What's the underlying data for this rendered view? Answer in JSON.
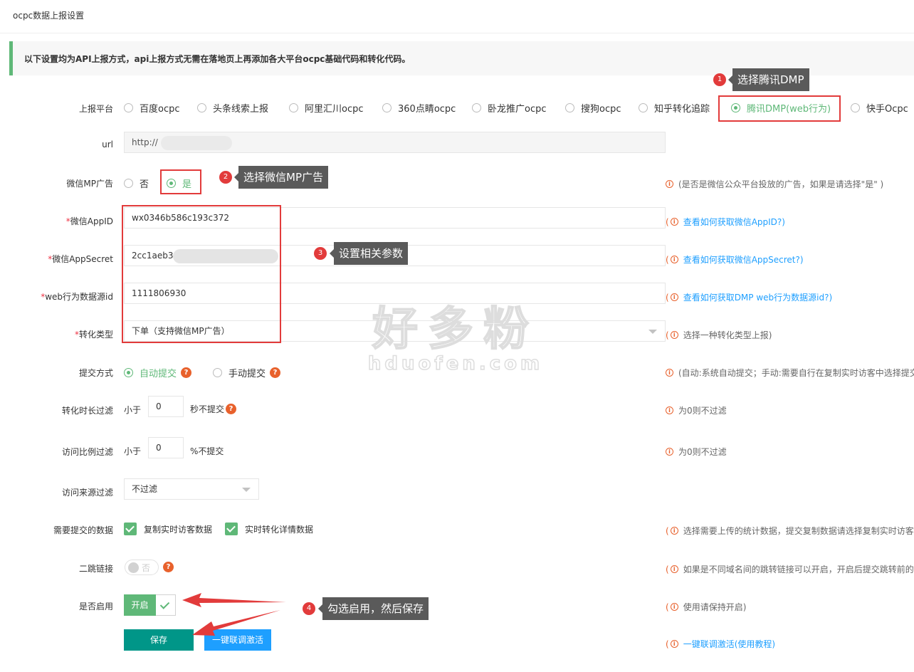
{
  "page_title": "ocpc数据上报设置",
  "notice": "以下设置均为API上报方式，api上报方式无需在落地页上再添加各大平台ocpc基础代码和转化代码。",
  "platform": {
    "label": "上报平台",
    "options": [
      "百度ocpc",
      "头条线索上报",
      "阿里汇川ocpc",
      "360点睛ocpc",
      "卧龙推广ocpc",
      "搜狗ocpc",
      "知乎转化追踪",
      "腾讯DMP(web行为)",
      "快手Ocpc"
    ],
    "selected": "腾讯DMP(web行为)"
  },
  "url": {
    "label": "url",
    "value": "http://"
  },
  "wechat_mp": {
    "label": "微信MP广告",
    "no": "否",
    "yes": "是",
    "tip": "(是否是微信公众平台投放的广告，如果是请选择\"是\" )"
  },
  "appid": {
    "required": "*",
    "label": "微信AppID",
    "value": "wx0346b586c193c372",
    "tip_paren": "(",
    "tip_link": "查看如何获取微信AppID?)"
  },
  "appsecret": {
    "required": "*",
    "label": "微信AppSecret",
    "value": "2cc1aeb3",
    "tip_paren": "(",
    "tip_link": "查看如何获取微信AppSecret?)"
  },
  "web_source": {
    "required": "*",
    "label": "web行为数据源id",
    "value": "1111806930",
    "tip_paren": "(",
    "tip_link": "查看如何获取DMP web行为数据源id?)"
  },
  "conversion": {
    "required": "*",
    "label": "转化类型",
    "value": "下单（支持微信MP广告）",
    "tip": "选择一种转化类型上报)"
  },
  "submit_mode": {
    "label": "提交方式",
    "auto": "自动提交",
    "manual": "手动提交",
    "q": "?",
    "tip": "(自动:系统自动提交；手动:需要自行在复制实时访客中选择提交"
  },
  "duration_filter": {
    "label": "转化时长过滤",
    "prefix": "小于",
    "value": "0",
    "suffix": "秒不提交",
    "q": "?",
    "tip": "为0则不过滤"
  },
  "ratio_filter": {
    "label": "访问比例过滤",
    "prefix": "小于",
    "value": "0",
    "suffix": "%不提交",
    "tip": "为0则不过滤"
  },
  "source_filter": {
    "label": "访问来源过滤",
    "value": "不过滤"
  },
  "data_to_submit": {
    "label": "需要提交的数据",
    "opt1": "复制实时访客数据",
    "opt2": "实时转化详情数据",
    "tip": "选择需要上传的统计数据，提交复制数据请选择复制实时访客,"
  },
  "redirect": {
    "label": "二跳链接",
    "switch_text": "否",
    "q": "?",
    "tip": "如果是不同域名间的跳转链接可以开启，开启后提交跳转前的链"
  },
  "enable": {
    "label": "是否启用",
    "on_text": "开启",
    "tip": "使用请保持开启)"
  },
  "buttons": {
    "save": "保存",
    "activate": "一键联调激活"
  },
  "activate_tip": "一键联调激活(使用教程)",
  "annotations": [
    {
      "num": "1",
      "text": "选择腾讯DMP"
    },
    {
      "num": "2",
      "text": "选择微信MP广告"
    },
    {
      "num": "3",
      "text": "设置相关参数"
    },
    {
      "num": "4",
      "text": "勾选启用，然后保存"
    }
  ],
  "watermark": {
    "cn": "好多粉",
    "en": "hduofen.com"
  },
  "colors": {
    "accent_green": "#5fb878",
    "teal": "#009688",
    "blue": "#1e9fff",
    "annotation_red": "#e23b3b",
    "tip_orange": "#e8612c"
  }
}
